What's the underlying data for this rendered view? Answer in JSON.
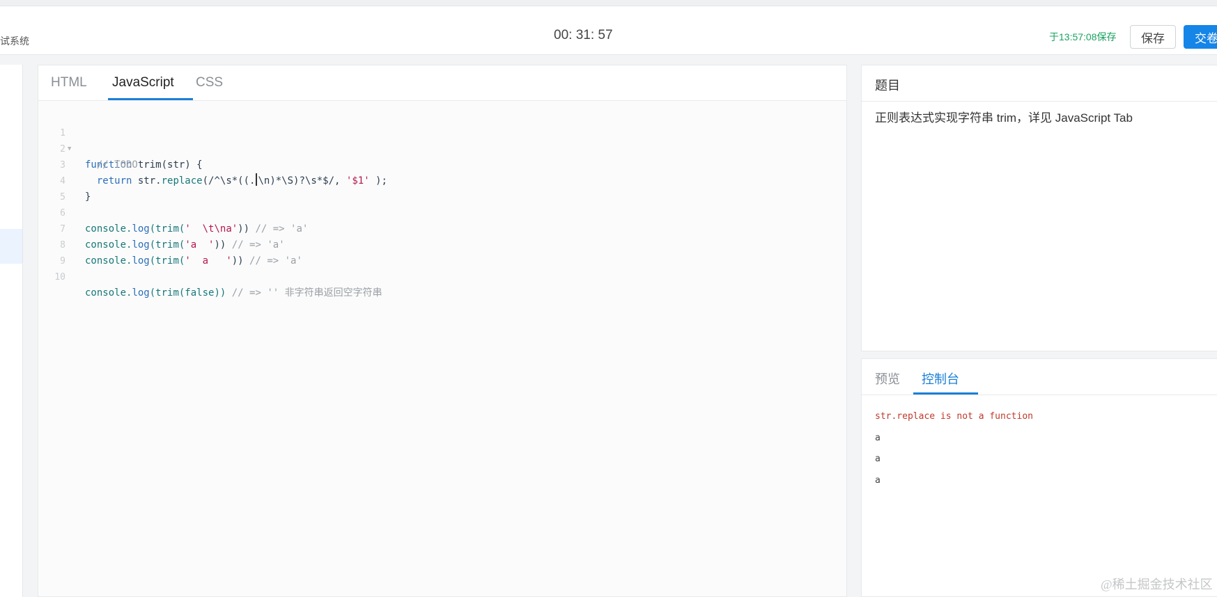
{
  "header": {
    "brand": "试系统",
    "timer": "00: 31: 57",
    "saved_status": "于13:57:08保存",
    "save_label": "保存",
    "submit_label": "交卷"
  },
  "editor": {
    "tabs": [
      "HTML",
      "JavaScript",
      "CSS"
    ],
    "active_tab": "JavaScript",
    "line_numbers": [
      "1",
      "2",
      "3",
      "4",
      "5",
      "6",
      "7",
      "8",
      "9",
      "10"
    ],
    "code": {
      "l1_kw": "function",
      "l1_rest": " trim(str) {",
      "l2": "  // TODO",
      "l3_kw": "  return",
      "l3_a": " str.",
      "l3_fn": "replace",
      "l3_b": "(/^\\s*((.",
      "l3_c": "\\n)*\\S)?\\s*$/, ",
      "l3_str": "'$1'",
      "l3_d": " );",
      "l4": "}",
      "l6_a": "console.",
      "l6_fn": "log",
      "l6_b": "(trim(",
      "l6_str": "'  \\t\\na'",
      "l6_c": ")) ",
      "l6_cm": "// => 'a'",
      "l7_a": "console.",
      "l7_fn": "log",
      "l7_b": "(trim(",
      "l7_str": "'a  '",
      "l7_c": ")) ",
      "l7_cm": "// => 'a'",
      "l8_a": "console.",
      "l8_fn": "log",
      "l8_b": "(trim(",
      "l8_str": "'  a   '",
      "l8_c": ")) ",
      "l8_cm": "// => 'a'",
      "l10_a": "console.",
      "l10_fn": "log",
      "l10_b": "(trim(false)) ",
      "l10_cm": "// => '' 非字符串返回空字符串"
    }
  },
  "question": {
    "title": "题目",
    "body": "正则表达式实现字符串 trim，详见 JavaScript Tab"
  },
  "console": {
    "tabs": [
      "预览",
      "控制台"
    ],
    "active_tab": "控制台",
    "lines": [
      "str.replace is not a function",
      "a",
      "a",
      "a"
    ]
  },
  "watermark": "@稀土掘金技术社区",
  "colors": {
    "accent": "#1a7fd6",
    "primary_button": "#1585e8",
    "saved_green": "#1aa260",
    "error_red": "#c0392b"
  }
}
